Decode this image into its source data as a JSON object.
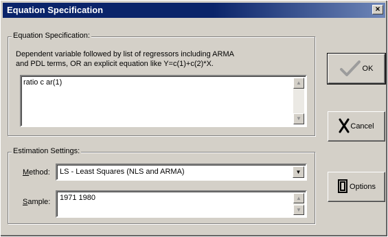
{
  "window": {
    "title": "Equation Specification"
  },
  "equation_group": {
    "label": "Equation Specification:",
    "help_line_1": "Dependent variable followed by list of regressors including ARMA",
    "help_line_2": "and PDL terms, OR an explicit equation like Y=c(1)+c(2)*X.",
    "value": "ratio c ar(1)"
  },
  "estimation_group": {
    "label": "Estimation Settings:",
    "method_label": "Method:",
    "method_value": "LS  -  Least Squares (NLS and ARMA)",
    "sample_label": "Sample:",
    "sample_value": "1971 1980"
  },
  "buttons": {
    "ok": "OK",
    "cancel": "Cancel",
    "options": "Options"
  },
  "icons": [
    "close-icon",
    "scroll-up-icon",
    "scroll-down-icon",
    "checkmark-icon",
    "cancel-x-icon",
    "options-icon",
    "dropdown-arrow-icon"
  ]
}
